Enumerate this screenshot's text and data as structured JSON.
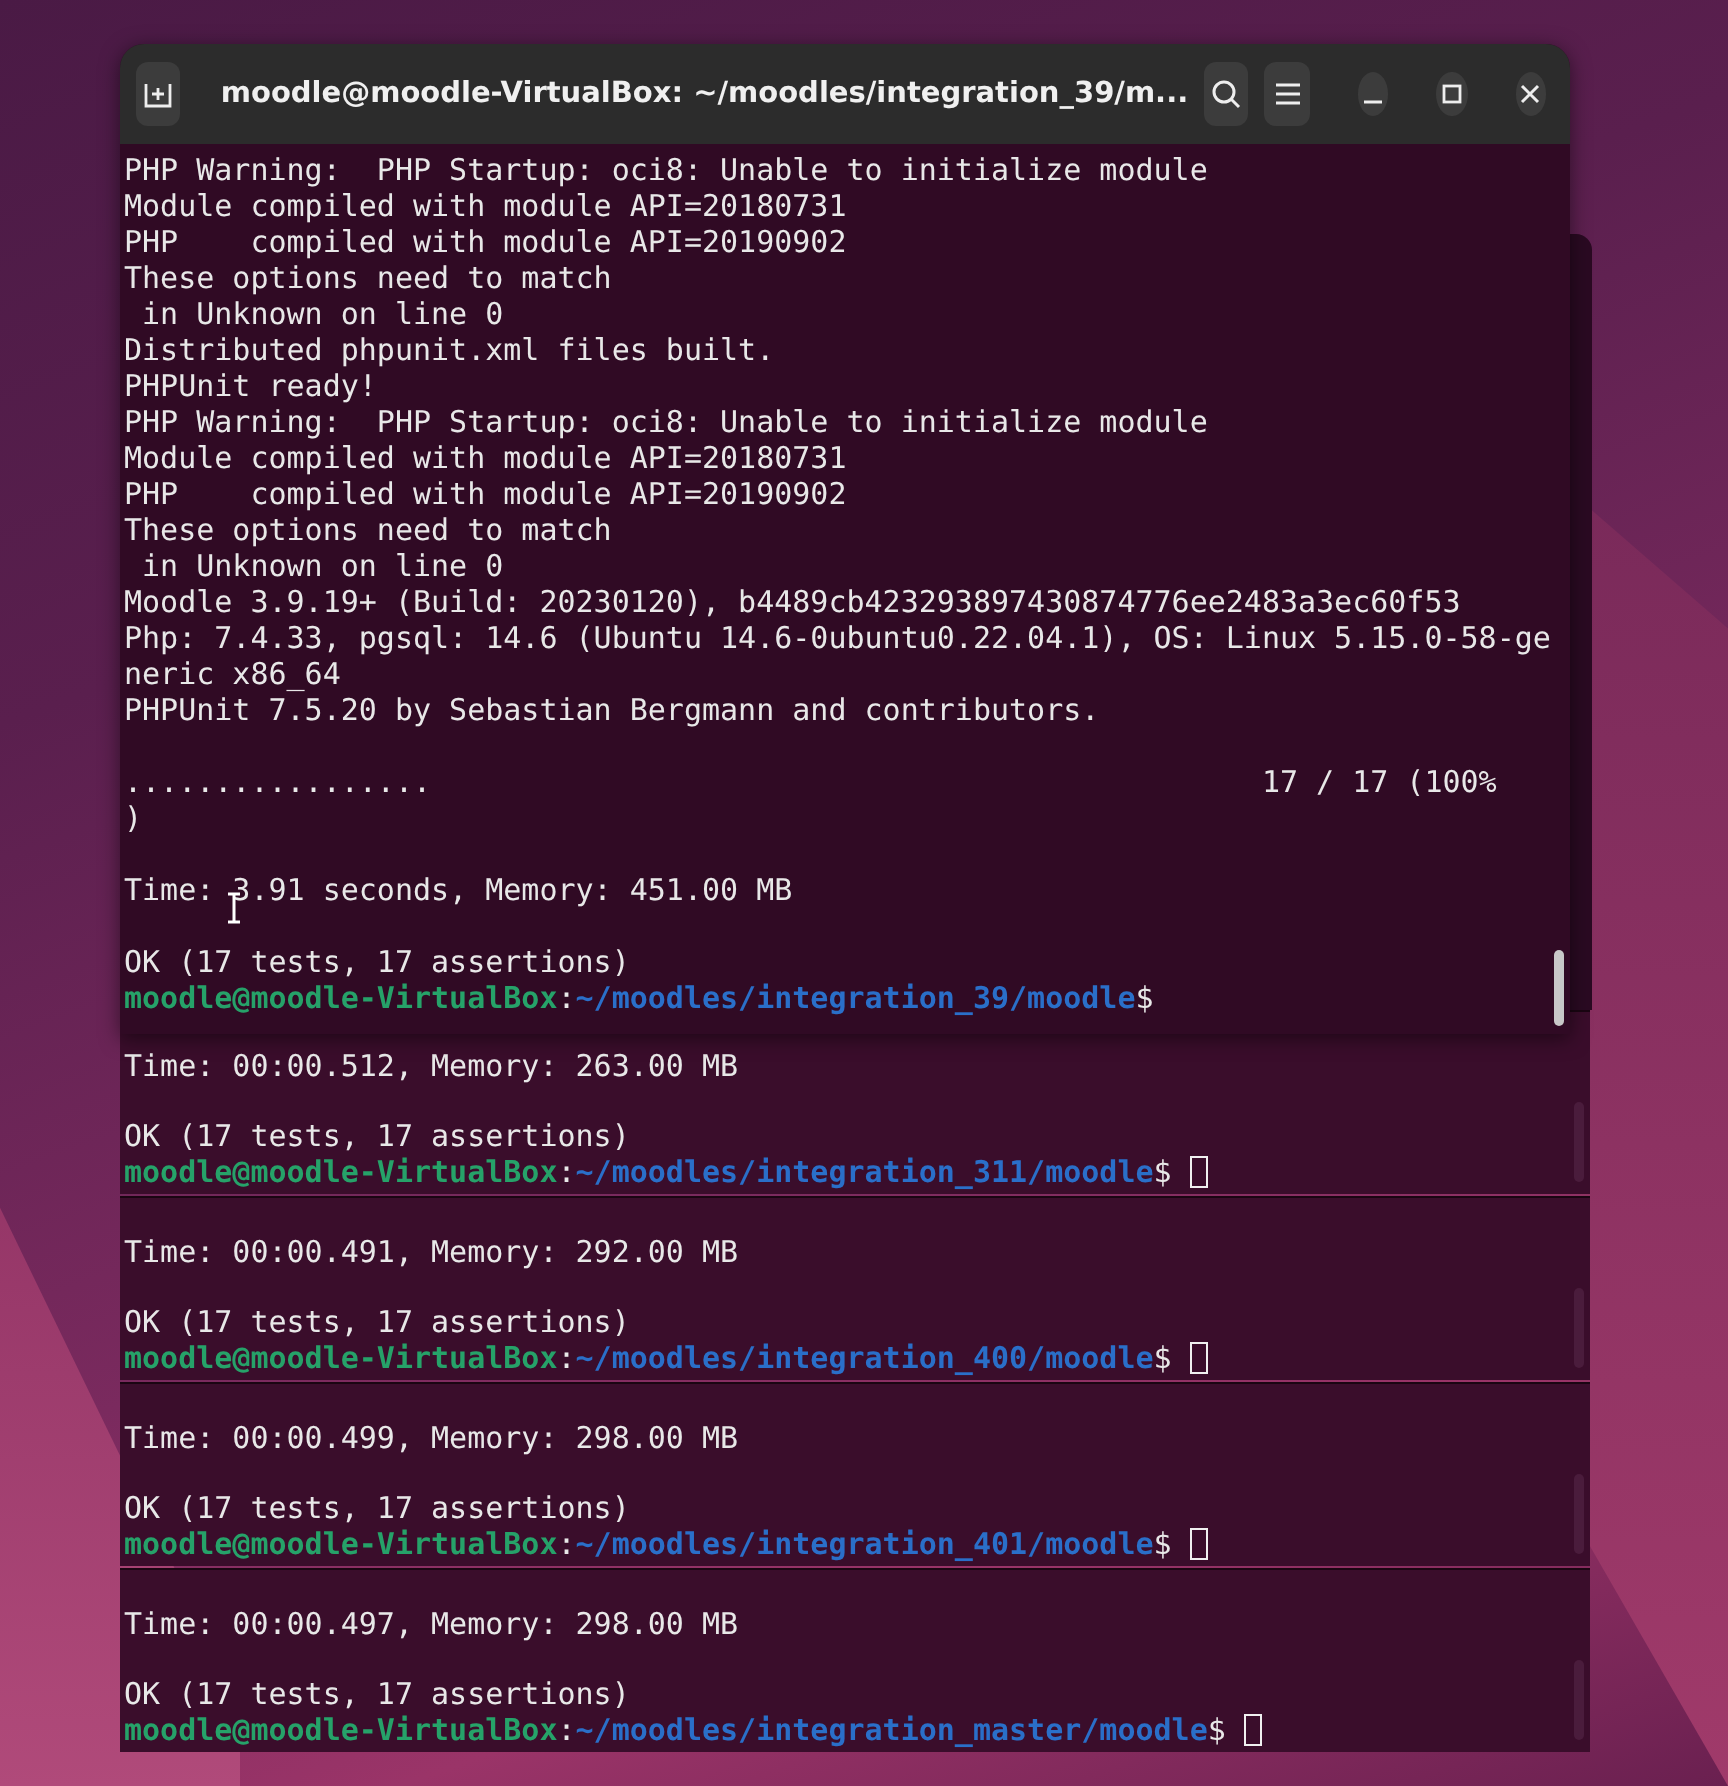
{
  "main_window": {
    "title": "moodle@moodle-VirtualBox: ~/moodles/integration_39/m...",
    "lines": [
      {
        "kind": "text",
        "text": "PHP Warning:  PHP Startup: oci8: Unable to initialize module"
      },
      {
        "kind": "text",
        "text": "Module compiled with module API=20180731"
      },
      {
        "kind": "text",
        "text": "PHP    compiled with module API=20190902"
      },
      {
        "kind": "text",
        "text": "These options need to match"
      },
      {
        "kind": "text",
        "text": " in Unknown on line 0"
      },
      {
        "kind": "text",
        "text": "Distributed phpunit.xml files built."
      },
      {
        "kind": "text",
        "text": "PHPUnit ready!"
      },
      {
        "kind": "text",
        "text": "PHP Warning:  PHP Startup: oci8: Unable to initialize module"
      },
      {
        "kind": "text",
        "text": "Module compiled with module API=20180731"
      },
      {
        "kind": "text",
        "text": "PHP    compiled with module API=20190902"
      },
      {
        "kind": "text",
        "text": "These options need to match"
      },
      {
        "kind": "text",
        "text": " in Unknown on line 0"
      },
      {
        "kind": "text",
        "text": "Moodle 3.9.19+ (Build: 20230120), b4489cb423293897430874776ee2483a3ec60f53"
      },
      {
        "kind": "text",
        "text": "Php: 7.4.33, pgsql: 14.6 (Ubuntu 14.6-0ubuntu0.22.04.1), OS: Linux 5.15.0-58-ge"
      },
      {
        "kind": "text",
        "text": "neric x86_64"
      },
      {
        "kind": "text",
        "text": "PHPUnit 7.5.20 by Sebastian Bergmann and contributors."
      },
      {
        "kind": "blank"
      },
      {
        "kind": "text",
        "text": ".................                                              17 / 17 (100%"
      },
      {
        "kind": "text",
        "text": ")"
      },
      {
        "kind": "blank"
      },
      {
        "kind": "text",
        "text": "Time: 3.91 seconds, Memory: 451.00 MB"
      },
      {
        "kind": "blank"
      },
      {
        "kind": "text",
        "text": "OK (17 tests, 17 assertions)"
      },
      {
        "kind": "prompt",
        "user": "moodle@moodle-VirtualBox",
        "separator": ":",
        "path": "~/moodles/integration_39/moodle",
        "symbol": "$",
        "cursor": false
      }
    ]
  },
  "back_windows": [
    {
      "lines": [
        {
          "kind": "blank"
        },
        {
          "kind": "text",
          "text": "Time: 00:00.512, Memory: 263.00 MB"
        },
        {
          "kind": "blank"
        },
        {
          "kind": "text",
          "text": "OK (17 tests, 17 assertions)"
        },
        {
          "kind": "prompt",
          "user": "moodle@moodle-VirtualBox",
          "separator": ":",
          "path": "~/moodles/integration_311/moodle",
          "symbol": "$",
          "cursor": true
        }
      ]
    },
    {
      "lines": [
        {
          "kind": "blank"
        },
        {
          "kind": "text",
          "text": "Time: 00:00.491, Memory: 292.00 MB"
        },
        {
          "kind": "blank"
        },
        {
          "kind": "text",
          "text": "OK (17 tests, 17 assertions)"
        },
        {
          "kind": "prompt",
          "user": "moodle@moodle-VirtualBox",
          "separator": ":",
          "path": "~/moodles/integration_400/moodle",
          "symbol": "$",
          "cursor": true
        }
      ]
    },
    {
      "lines": [
        {
          "kind": "blank"
        },
        {
          "kind": "text",
          "text": "Time: 00:00.499, Memory: 298.00 MB"
        },
        {
          "kind": "blank"
        },
        {
          "kind": "text",
          "text": "OK (17 tests, 17 assertions)"
        },
        {
          "kind": "prompt",
          "user": "moodle@moodle-VirtualBox",
          "separator": ":",
          "path": "~/moodles/integration_401/moodle",
          "symbol": "$",
          "cursor": true
        }
      ]
    },
    {
      "lines": [
        {
          "kind": "blank"
        },
        {
          "kind": "text",
          "text": "Time: 00:00.497, Memory: 298.00 MB"
        },
        {
          "kind": "blank"
        },
        {
          "kind": "text",
          "text": "OK (17 tests, 17 assertions)"
        },
        {
          "kind": "prompt",
          "user": "moodle@moodle-VirtualBox",
          "separator": ":",
          "path": "~/moodles/integration_master/moodle",
          "symbol": "$",
          "cursor": true
        }
      ]
    }
  ]
}
